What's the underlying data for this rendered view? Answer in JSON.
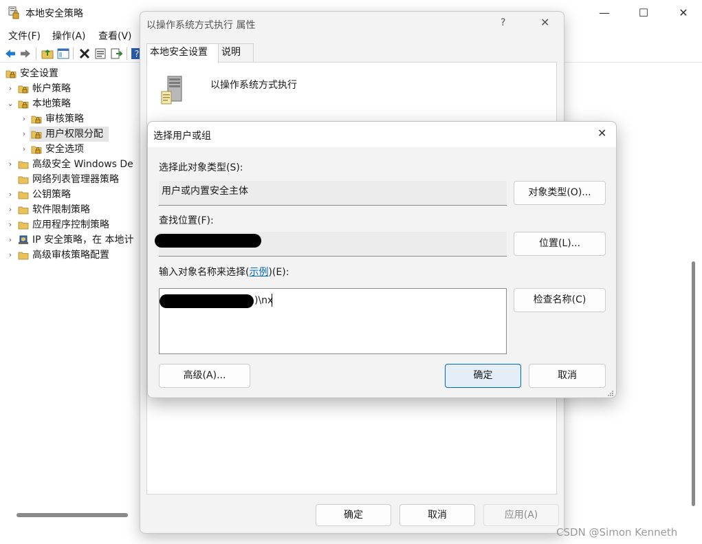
{
  "main_window": {
    "title": "本地安全策略",
    "menu": [
      "文件(F)",
      "操作(A)",
      "查看(V)"
    ],
    "caption": {
      "minimize": "—",
      "maximize": "☐",
      "close": "✕"
    }
  },
  "tree": {
    "items": [
      {
        "label": "安全设置",
        "arrow": ""
      },
      {
        "label": "帐户策略",
        "arrow": "›"
      },
      {
        "label": "本地策略",
        "arrow": "⌄"
      },
      {
        "label": "审核策略",
        "arrow": "›"
      },
      {
        "label": "用户权限分配",
        "arrow": "›",
        "selected": true
      },
      {
        "label": "安全选项",
        "arrow": "›"
      },
      {
        "label": "高级安全 Windows De",
        "arrow": "›"
      },
      {
        "label": "网络列表管理器策略",
        "arrow": ""
      },
      {
        "label": "公钥策略",
        "arrow": "›"
      },
      {
        "label": "软件限制策略",
        "arrow": "›"
      },
      {
        "label": "应用程序控制策略",
        "arrow": "›"
      },
      {
        "label": "IP 安全策略，在 本地计",
        "arrow": "›"
      },
      {
        "label": "高级审核策略配置",
        "arrow": "›"
      }
    ]
  },
  "properties_dialog": {
    "title": "以操作系统方式执行 属性",
    "help": "?",
    "close": "✕",
    "tabs": [
      "本地安全设置",
      "说明"
    ],
    "policy_name": "以操作系统方式执行",
    "buttons": {
      "ok": "确定",
      "cancel": "取消",
      "apply": "应用(A)"
    }
  },
  "select_dialog": {
    "title": "选择用户或组",
    "close": "✕",
    "object_type_label": "选择此对象类型(S):",
    "object_type_value": "用户或内置安全主体",
    "object_types_button": "对象类型(O)...",
    "location_label": "查找位置(F):",
    "location_button": "位置(L)...",
    "names_label_prefix": "输入对象名称来选择(",
    "names_label_link": "示例",
    "names_label_suffix": ")(E):",
    "names_value": ")\\nx",
    "check_names_button": "检查名称(C)",
    "advanced_button": "高级(A)...",
    "ok_button": "确定",
    "cancel_button": "取消"
  },
  "watermark": "CSDN @Simon Kenneth",
  "colors": {
    "accent": "#0067c0",
    "folder": "#e8c25a",
    "lock": "#d9a531"
  }
}
